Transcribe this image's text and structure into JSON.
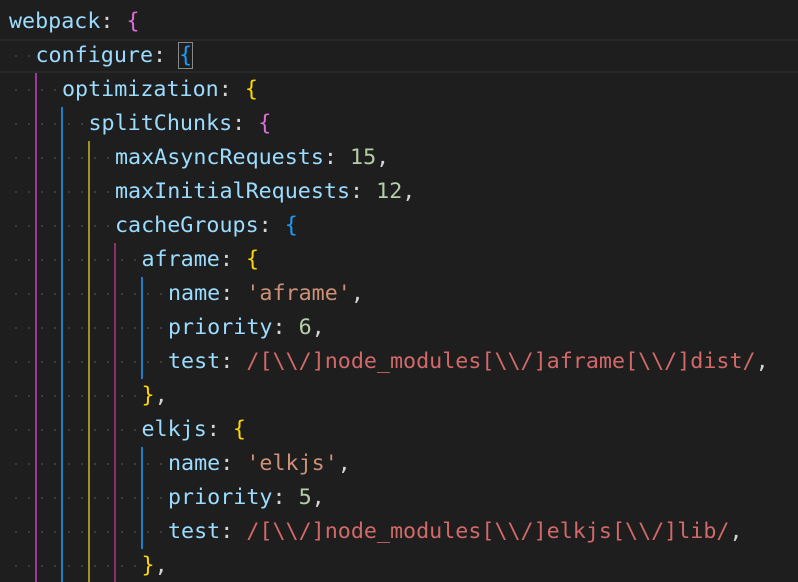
{
  "theme": {
    "background": "#1e1e1e",
    "property": "#9cdcfe",
    "punctuation": "#d4d4d4",
    "number": "#b5cea8",
    "string": "#ce9178",
    "regex": "#d16969",
    "bracket_levels": [
      "#ffd700",
      "#da70d6",
      "#179fff"
    ],
    "indent_guides": [
      "#9b3a9b",
      "#1f7dc9",
      "#a0902a",
      "#8f2d6d",
      "#1f7dc9"
    ]
  },
  "editor": {
    "active_line": 2,
    "lines": [
      {
        "indent": 0,
        "tokens": [
          {
            "t": "webpack",
            "c": "key"
          },
          {
            "t": ": ",
            "c": "punct"
          },
          {
            "t": "{",
            "c": "b-purple"
          }
        ]
      },
      {
        "indent": 1,
        "tokens": [
          {
            "t": "configure",
            "c": "key"
          },
          {
            "t": ": ",
            "c": "punct"
          },
          {
            "t": "{",
            "c": "b-blue",
            "match": true
          }
        ]
      },
      {
        "indent": 2,
        "tokens": [
          {
            "t": "optimization",
            "c": "key"
          },
          {
            "t": ": ",
            "c": "punct"
          },
          {
            "t": "{",
            "c": "b-gold"
          }
        ]
      },
      {
        "indent": 3,
        "tokens": [
          {
            "t": "splitChunks",
            "c": "key"
          },
          {
            "t": ": ",
            "c": "punct"
          },
          {
            "t": "{",
            "c": "b-purple"
          }
        ]
      },
      {
        "indent": 4,
        "tokens": [
          {
            "t": "maxAsyncRequests",
            "c": "key"
          },
          {
            "t": ": ",
            "c": "punct"
          },
          {
            "t": "15",
            "c": "num"
          },
          {
            "t": ",",
            "c": "punct"
          }
        ]
      },
      {
        "indent": 4,
        "tokens": [
          {
            "t": "maxInitialRequests",
            "c": "key"
          },
          {
            "t": ": ",
            "c": "punct"
          },
          {
            "t": "12",
            "c": "num"
          },
          {
            "t": ",",
            "c": "punct"
          }
        ]
      },
      {
        "indent": 4,
        "tokens": [
          {
            "t": "cacheGroups",
            "c": "key"
          },
          {
            "t": ": ",
            "c": "punct"
          },
          {
            "t": "{",
            "c": "b-blue"
          }
        ]
      },
      {
        "indent": 5,
        "tokens": [
          {
            "t": "aframe",
            "c": "key"
          },
          {
            "t": ": ",
            "c": "punct"
          },
          {
            "t": "{",
            "c": "b-gold"
          }
        ]
      },
      {
        "indent": 6,
        "tokens": [
          {
            "t": "name",
            "c": "key"
          },
          {
            "t": ": ",
            "c": "punct"
          },
          {
            "t": "'aframe'",
            "c": "str"
          },
          {
            "t": ",",
            "c": "punct"
          }
        ]
      },
      {
        "indent": 6,
        "tokens": [
          {
            "t": "priority",
            "c": "key"
          },
          {
            "t": ": ",
            "c": "punct"
          },
          {
            "t": "6",
            "c": "num"
          },
          {
            "t": ",",
            "c": "punct"
          }
        ]
      },
      {
        "indent": 6,
        "tokens": [
          {
            "t": "test",
            "c": "key"
          },
          {
            "t": ": ",
            "c": "punct"
          },
          {
            "t": "/[\\\\/]node_modules[\\\\/]aframe[\\\\/]dist/",
            "c": "regex"
          },
          {
            "t": ",",
            "c": "punct"
          }
        ]
      },
      {
        "indent": 5,
        "tokens": [
          {
            "t": "}",
            "c": "b-gold"
          },
          {
            "t": ",",
            "c": "punct"
          }
        ]
      },
      {
        "indent": 5,
        "tokens": [
          {
            "t": "elkjs",
            "c": "key"
          },
          {
            "t": ": ",
            "c": "punct"
          },
          {
            "t": "{",
            "c": "b-gold"
          }
        ]
      },
      {
        "indent": 6,
        "tokens": [
          {
            "t": "name",
            "c": "key"
          },
          {
            "t": ": ",
            "c": "punct"
          },
          {
            "t": "'elkjs'",
            "c": "str"
          },
          {
            "t": ",",
            "c": "punct"
          }
        ]
      },
      {
        "indent": 6,
        "tokens": [
          {
            "t": "priority",
            "c": "key"
          },
          {
            "t": ": ",
            "c": "punct"
          },
          {
            "t": "5",
            "c": "num"
          },
          {
            "t": ",",
            "c": "punct"
          }
        ]
      },
      {
        "indent": 6,
        "tokens": [
          {
            "t": "test",
            "c": "key"
          },
          {
            "t": ": ",
            "c": "punct"
          },
          {
            "t": "/[\\\\/]node_modules[\\\\/]elkjs[\\\\/]lib/",
            "c": "regex"
          },
          {
            "t": ",",
            "c": "punct"
          }
        ]
      },
      {
        "indent": 5,
        "tokens": [
          {
            "t": "}",
            "c": "b-gold"
          },
          {
            "t": ",",
            "c": "punct"
          }
        ]
      }
    ]
  }
}
